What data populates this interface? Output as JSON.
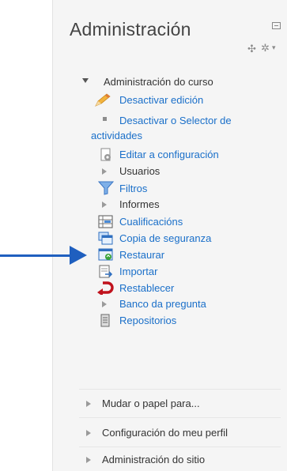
{
  "block": {
    "title": "Administración"
  },
  "course_admin": {
    "heading": "Administración do curso",
    "items": [
      {
        "label": "Desactivar edición",
        "icon": "pencil-icon"
      },
      {
        "label_line1": "Desactivar o Selector de",
        "label_line2": "actividades",
        "icon": "square-bullet-icon"
      },
      {
        "label": "Editar a configuración",
        "icon": "settings-doc-icon"
      },
      {
        "label": "Usuarios",
        "icon": "triangle-right-icon"
      },
      {
        "label": "Filtros",
        "icon": "filter-icon"
      },
      {
        "label": "Informes",
        "icon": "triangle-right-icon"
      },
      {
        "label": "Cualificacións",
        "icon": "grades-icon"
      },
      {
        "label": "Copia de seguranza",
        "icon": "backup-icon"
      },
      {
        "label": "Restaurar",
        "icon": "restore-icon"
      },
      {
        "label": "Importar",
        "icon": "import-icon"
      },
      {
        "label": "Restablecer",
        "icon": "reset-icon"
      },
      {
        "label": "Banco da pregunta",
        "icon": "triangle-right-icon"
      },
      {
        "label": "Repositorios",
        "icon": "repository-icon"
      }
    ]
  },
  "bottom_items": [
    {
      "label": "Mudar o papel para..."
    },
    {
      "label": "Configuración do meu perfil"
    },
    {
      "label": "Administración do sitio"
    }
  ],
  "colors": {
    "link": "#1a6fc9",
    "arrow": "#1f5fbf",
    "panel_bg": "#f5f5f5"
  }
}
